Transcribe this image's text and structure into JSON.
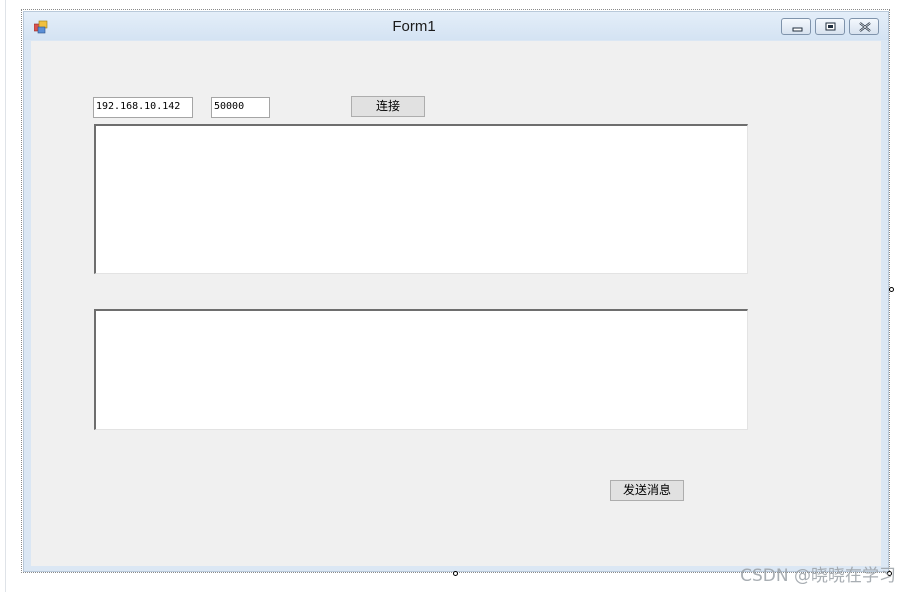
{
  "form": {
    "title": "Form1"
  },
  "inputs": {
    "ip_value": "192.168.10.142",
    "port_value": "50000"
  },
  "buttons": {
    "connect_label": "连接",
    "send_label": "发送消息"
  },
  "textareas": {
    "receive_value": "",
    "send_value": ""
  },
  "icons": {
    "app": "form-app-icon",
    "minimize": "minimize-icon",
    "maximize": "maximize-icon",
    "close": "close-icon"
  },
  "watermark": {
    "text": "CSDN @晓晓在学习"
  }
}
